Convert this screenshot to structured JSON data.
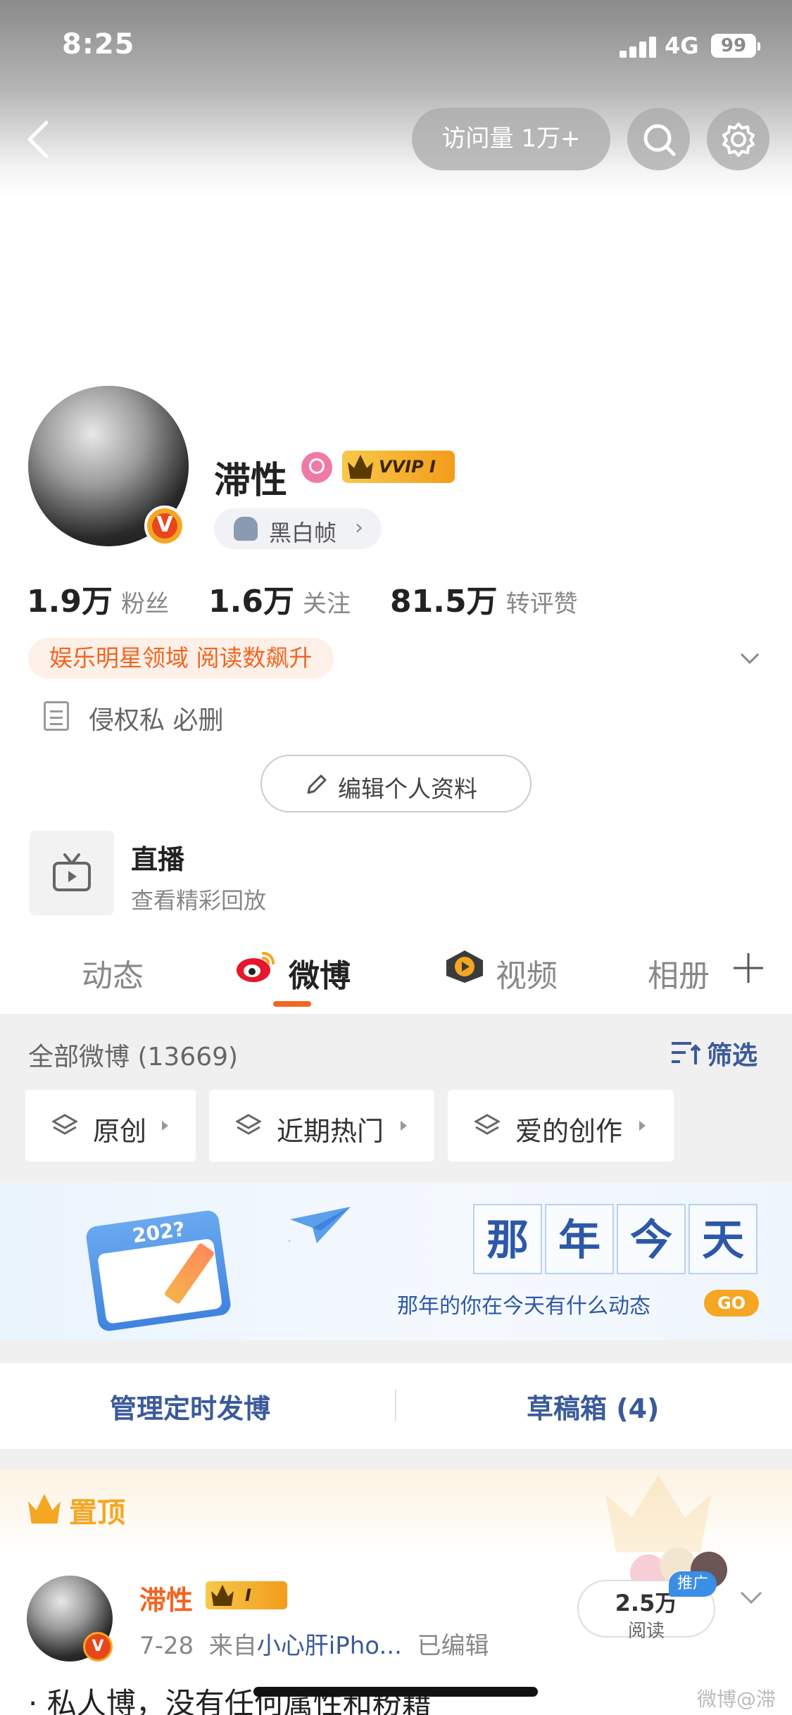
{
  "status": {
    "time": "8:25",
    "network": "4G",
    "battery": "99"
  },
  "header": {
    "visits": "访问量 1万+"
  },
  "profile": {
    "name": "滞性",
    "vip": "VVIP I",
    "tag": "黑白帧",
    "verified_mark": "V",
    "stats": [
      {
        "num": "1.9万",
        "label": "粉丝"
      },
      {
        "num": "1.6万",
        "label": "关注"
      },
      {
        "num": "81.5万",
        "label": "转评赞"
      }
    ],
    "domain": "娱乐明星领域 阅读数飙升",
    "bio": "侵权私 必删",
    "edit_label": "编辑个人资料",
    "live_title": "直播",
    "live_sub": "查看精彩回放"
  },
  "tabs": [
    {
      "label": "动态"
    },
    {
      "label": "微博"
    },
    {
      "label": "视频"
    },
    {
      "label": "相册"
    }
  ],
  "feed": {
    "all_label": "全部微博 (13669)",
    "filter_label": "筛选",
    "chips": [
      {
        "label": "原创"
      },
      {
        "label": "近期热门"
      },
      {
        "label": "爱的创作"
      }
    ]
  },
  "banner": {
    "year": "202?",
    "title_chars": [
      "那",
      "年",
      "今",
      "天"
    ],
    "subtitle": "那年的你在今天有什么动态",
    "go": "GO"
  },
  "actions": {
    "scheduled": "管理定时发博",
    "drafts": "草稿箱 (4)"
  },
  "pinned": {
    "label": "置顶",
    "author": "滞性",
    "badge": "I",
    "verified_mark": "V",
    "date": "7-28",
    "source_prefix": "来自",
    "source": "小心肝iPho...",
    "edited": "已编辑",
    "reads_num": "2.5万",
    "reads_label": "阅读",
    "promo": "推广",
    "text": "· 私人博，没有任何属性和粉籍"
  },
  "watermark": "微博@滞性",
  "colors": {
    "accent": "#f26522",
    "link": "#3b5a9a",
    "gold": "#f5a623"
  },
  "icons": [
    "back-icon",
    "search-icon",
    "gear-icon",
    "doc-icon",
    "edit-pencil-icon",
    "tv-icon",
    "weibo-logo-icon",
    "video-logo-icon",
    "plus-icon",
    "filter-icon",
    "layers-icon",
    "chevron-down-icon"
  ]
}
